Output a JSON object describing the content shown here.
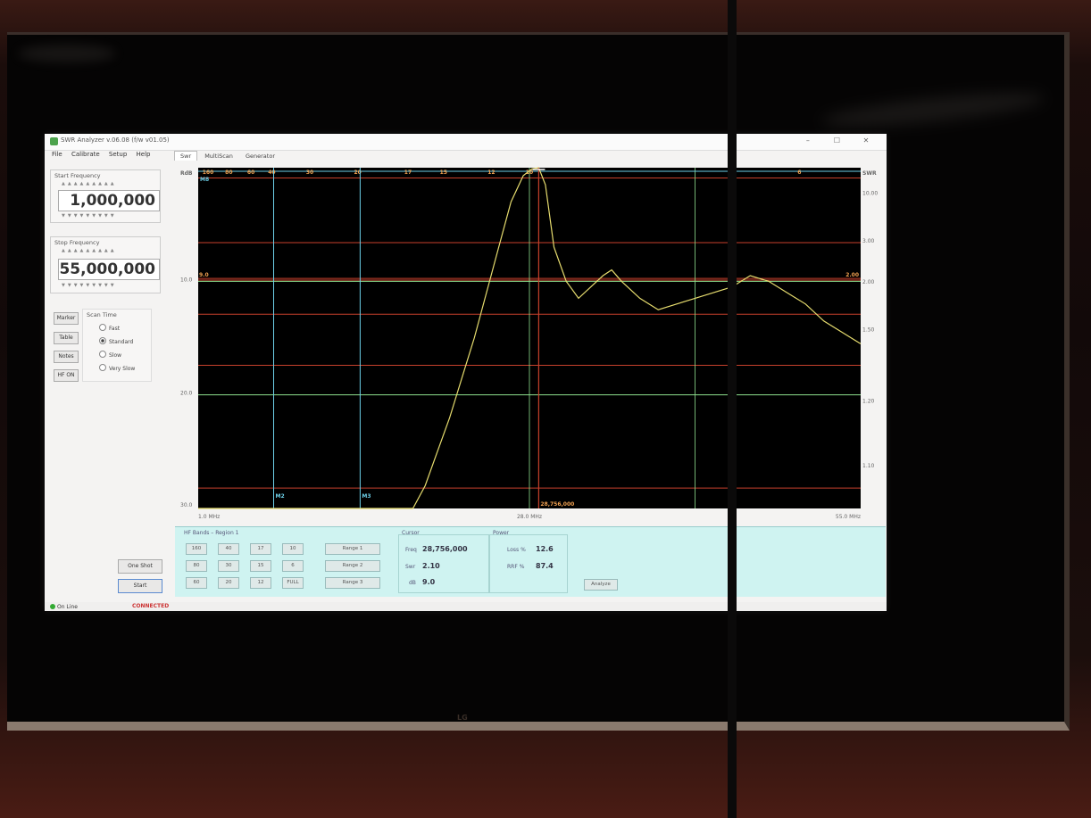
{
  "window": {
    "title": "SWR Analyzer v.06.08 (f/w v01.05)",
    "menus": [
      "File",
      "Calibrate",
      "Setup",
      "Help"
    ],
    "tabs": [
      "Swr",
      "MultiScan",
      "Generator"
    ],
    "win_controls": [
      "–",
      "☐",
      "✕"
    ]
  },
  "left": {
    "start_label": "Start Frequency",
    "start_value": "1,000,000",
    "stop_label": "Stop Frequency",
    "stop_value": "55,000,000",
    "scan_time_label": "Scan Time",
    "buttons": [
      "Marker",
      "Table",
      "Notes",
      "HF ON"
    ],
    "scan_options": [
      "Fast",
      "Standard",
      "Slow",
      "Very Slow"
    ],
    "selected_scan": "Standard",
    "one_shot": "One Shot",
    "start": "Start"
  },
  "chart_data": {
    "type": "line",
    "x_start_mhz": 1.0,
    "x_end_mhz": 55.0,
    "x_tick_labels": [
      "1.0 MHz",
      "28.0 MHz",
      "55.0 MHz"
    ],
    "left_axis_title": "RdB",
    "right_axis_title": "SWR",
    "left_tick_labels": [
      "10.0",
      "20.0",
      "30.0"
    ],
    "right_tick_labels": [
      "10.00",
      "3.00",
      "2.00",
      "1.50",
      "1.20",
      "1.10"
    ],
    "band_labels": [
      "160",
      "80",
      "60",
      "40",
      "30",
      "20",
      "17",
      "15",
      "12",
      "10",
      "6"
    ],
    "band_mhz": [
      1.8,
      3.5,
      5.3,
      7.0,
      10.1,
      14.0,
      18.1,
      21.0,
      24.9,
      28.0,
      50.0
    ],
    "markers": [
      {
        "name": "M2",
        "mhz": 7.15
      },
      {
        "name": "M3",
        "mhz": 14.2
      }
    ],
    "cursor_mhz": 28.756,
    "cursor_label": "28,756,000",
    "threshold_label_left": "9.0",
    "threshold_label_right": "2.00",
    "top_marker_label": "M8",
    "series": [
      {
        "x": [
          1.0,
          3.0,
          5.0,
          6.5,
          7.2,
          8.0,
          9.5,
          11.0,
          12.5,
          13.5,
          14.0,
          14.4,
          15.5,
          16.5,
          17.5,
          18.5,
          19.5,
          20.5,
          21.5,
          22.5,
          23.5,
          24.5,
          25.5,
          26.5,
          27.5,
          28.2,
          28.76,
          29.3,
          30.0,
          31.0,
          32.0,
          33.0,
          34.0,
          34.7,
          35.5,
          37.0,
          38.5,
          40.0,
          41.5,
          43.0,
          44.5,
          46.0,
          47.5,
          49.0,
          50.5,
          52.0,
          53.5,
          55.0
        ],
        "y": [
          30.0,
          30.0,
          30.0,
          30.0,
          30.0,
          30.0,
          30.0,
          30.0,
          30.0,
          30.0,
          30.0,
          30.0,
          30.0,
          30.0,
          30.0,
          30.0,
          28.0,
          25.0,
          22.0,
          18.5,
          15.0,
          11.0,
          7.0,
          3.0,
          0.7,
          0.1,
          0.0,
          1.5,
          7.0,
          10.0,
          11.5,
          10.5,
          9.5,
          9.0,
          10.0,
          11.5,
          12.5,
          12.0,
          11.5,
          11.0,
          10.5,
          9.5,
          10.0,
          11.0,
          12.0,
          13.5,
          14.5,
          15.5
        ]
      }
    ]
  },
  "bottom": {
    "bands_title": "HF Bands – Region 1",
    "band_buttons": [
      [
        "160",
        "40",
        "17",
        "10",
        "Range 1"
      ],
      [
        "80",
        "30",
        "15",
        "6",
        "Range 2"
      ],
      [
        "60",
        "20",
        "12",
        "FULL",
        "Range 3"
      ]
    ],
    "cursor_title": "Cursor",
    "freq_label": "Freq",
    "freq_value": "28,756,000",
    "swr_label": "Swr",
    "swr_value": "2.10",
    "db_label": "dB",
    "db_value": "9.0",
    "power_title": "Power",
    "loss_label": "Loss %",
    "loss_value": "12.6",
    "ref_label": "RRF %",
    "ref_value": "87.4",
    "analyze": "Analyze"
  },
  "status": {
    "online": "On Line",
    "connected": "CONNECTED"
  },
  "monitor": {
    "brand": "LG"
  },
  "colors": {
    "plot_bg": "#000000",
    "trace": "#e6dc6e",
    "red_grid": "#c8412c",
    "green_grid": "#8ee08e",
    "marker_blue": "#6ccfe8",
    "band_label": "#f0a050",
    "panel_cyan": "#cff3f1"
  }
}
